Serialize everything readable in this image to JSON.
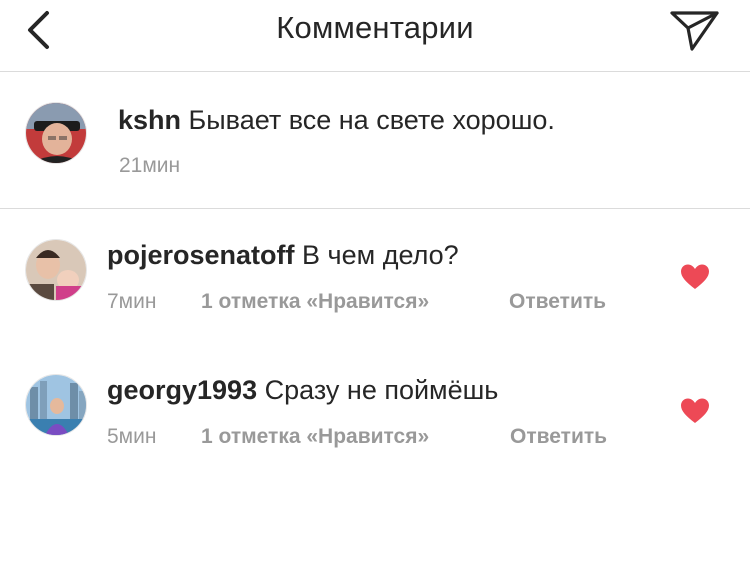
{
  "header": {
    "title": "Комментарии",
    "back_icon": "chevron-left-icon",
    "share_icon": "paper-plane-icon"
  },
  "caption": {
    "username": "kshn",
    "text": "Бывает все на свете хорошо.",
    "time": "21мин"
  },
  "comments": [
    {
      "username": "pojerosenatoff",
      "text": "В чем дело?",
      "time": "7мин",
      "likes": "1 отметка «Нравится»",
      "reply": "Ответить",
      "liked": true
    },
    {
      "username": "georgy1993",
      "text": "Сразу не поймёшь",
      "time": "5мин",
      "likes": "1 отметка «Нравится»",
      "reply": "Ответить",
      "liked": true
    }
  ],
  "colors": {
    "heart": "#ed4956",
    "meta": "#999999",
    "divider": "#dbdbdb",
    "text": "#262626"
  }
}
